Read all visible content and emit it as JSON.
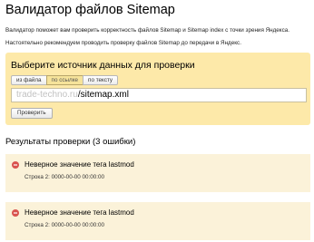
{
  "page": {
    "title": "Валидатор файлов Sitemap",
    "description_line1": "Валидатор поможет вам проверить корректность файлов Sitemap и Sitemap index с точки зрения Яндекса.",
    "description_line2": "Настоятельно рекомендуем проводить проверку файлов Sitemap до передачи в Яндекс."
  },
  "source": {
    "title": "Выберите источник данных для проверки",
    "tabs": [
      {
        "label": "из файла",
        "active": false
      },
      {
        "label": "по ссылке",
        "active": true
      },
      {
        "label": "по тексту",
        "active": false
      }
    ],
    "url_host": "trade-techno.ru",
    "url_path": "/sitemap.xml",
    "check_button": "Проверить"
  },
  "results": {
    "title": "Результаты проверки (3 ошибки)",
    "errors": [
      {
        "title": "Неверное значение тега lastmod",
        "detail": "Строка 2: 0000-00-00 00:00:00"
      },
      {
        "title": "Неверное значение тега lastmod",
        "detail": "Строка 2: 0000-00-00 00:00:00"
      }
    ]
  },
  "colors": {
    "source_panel": "#fde9a9",
    "error_card": "#fbf2d9",
    "error_icon": "#d9534f",
    "active_tab": "#f6e39a"
  }
}
